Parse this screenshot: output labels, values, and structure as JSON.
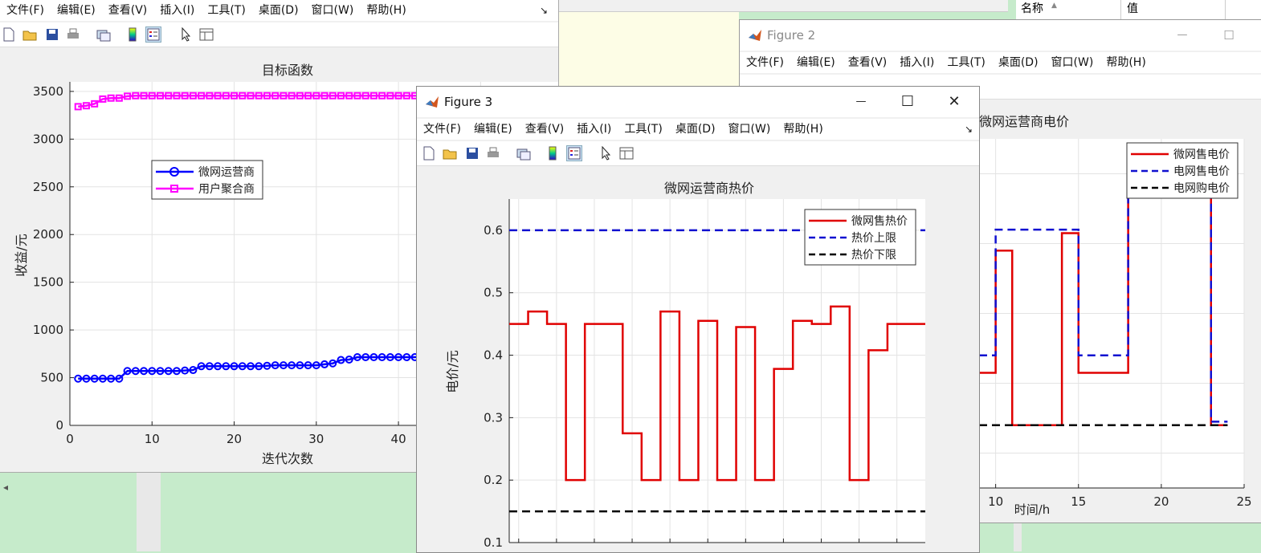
{
  "workspace": {
    "col_name": "名称",
    "col_value": "值",
    "sort_arrow": "▲"
  },
  "menu": [
    "文件(F)",
    "编辑(E)",
    "查看(V)",
    "插入(I)",
    "工具(T)",
    "桌面(D)",
    "窗口(W)",
    "帮助(H)"
  ],
  "fig1": {
    "menu_arrow": "↘",
    "chart_data": {
      "type": "line",
      "title": "目标函数",
      "xlabel": "迭代次数",
      "ylabel": "收益/元",
      "xlim": [
        0,
        48
      ],
      "ylim": [
        0,
        3600
      ],
      "xticks": [
        "0",
        "10",
        "20",
        "30",
        "40"
      ],
      "yticks": [
        "0",
        "500",
        "1000",
        "1500",
        "2000",
        "2500",
        "3000",
        "3500"
      ],
      "grid": true,
      "legend_position": "upper-left",
      "series": [
        {
          "name": "微网运营商",
          "color": "#0000ff",
          "marker": "circle",
          "x": [
            1,
            2,
            3,
            4,
            5,
            6,
            7,
            8,
            9,
            10,
            11,
            12,
            13,
            14,
            15,
            16,
            17,
            18,
            19,
            20,
            21,
            22,
            23,
            24,
            25,
            26,
            27,
            28,
            29,
            30,
            31,
            32,
            33,
            34,
            35,
            36,
            37,
            38,
            39,
            40,
            41,
            42,
            43,
            44,
            45,
            46,
            47
          ],
          "y": [
            490,
            490,
            490,
            490,
            490,
            490,
            570,
            570,
            570,
            570,
            570,
            570,
            570,
            575,
            580,
            620,
            620,
            620,
            620,
            620,
            620,
            620,
            620,
            625,
            630,
            630,
            630,
            630,
            630,
            630,
            640,
            650,
            685,
            690,
            715,
            715,
            715,
            715,
            715,
            715,
            715,
            715,
            718,
            718,
            720,
            720,
            720
          ]
        },
        {
          "name": "用户聚合商",
          "color": "#ff00ff",
          "marker": "square",
          "x": [
            1,
            2,
            3,
            4,
            5,
            6,
            7,
            8,
            9,
            10,
            11,
            12,
            13,
            14,
            15,
            16,
            17,
            18,
            19,
            20,
            21,
            22,
            23,
            24,
            25,
            26,
            27,
            28,
            29,
            30,
            31,
            32,
            33,
            34,
            35,
            36,
            37,
            38,
            39,
            40,
            41,
            42,
            43,
            44,
            45,
            46,
            47
          ],
          "y": [
            3340,
            3350,
            3370,
            3420,
            3430,
            3430,
            3450,
            3455,
            3455,
            3455,
            3455,
            3455,
            3455,
            3455,
            3455,
            3455,
            3455,
            3455,
            3455,
            3455,
            3455,
            3455,
            3455,
            3455,
            3455,
            3455,
            3455,
            3455,
            3455,
            3455,
            3455,
            3455,
            3455,
            3455,
            3455,
            3455,
            3455,
            3455,
            3455,
            3455,
            3455,
            3455,
            3455,
            3455,
            3455,
            3455,
            3455
          ]
        }
      ]
    }
  },
  "fig2": {
    "title": "Figure 2",
    "chart_data": {
      "type": "line",
      "title": "微网运营商电价",
      "xlabel": "时间/h",
      "xlim": [
        9,
        25
      ],
      "xticks": [
        "10",
        "15",
        "20",
        "25"
      ],
      "grid": true,
      "legend_position": "upper-right",
      "series": [
        {
          "name": "微网售电价",
          "color": "#e00000",
          "style": "solid",
          "x": [
            9,
            10,
            10,
            11,
            11,
            14,
            14,
            15,
            15,
            18,
            18,
            23,
            23,
            24
          ],
          "y": [
            0.43,
            0.43,
            0.78,
            0.78,
            0.28,
            0.28,
            0.83,
            0.83,
            0.43,
            0.43,
            0.98,
            0.98,
            0.28,
            0.28
          ]
        },
        {
          "name": "电网售电价",
          "color": "#1010d0",
          "style": "dashed",
          "x": [
            9,
            10,
            10,
            15,
            15,
            18,
            18,
            23,
            23,
            24
          ],
          "y": [
            0.48,
            0.48,
            0.84,
            0.84,
            0.48,
            0.48,
            0.98,
            0.98,
            0.29,
            0.29
          ]
        },
        {
          "name": "电网购电价",
          "color": "#000000",
          "style": "dashed",
          "x": [
            9,
            24
          ],
          "y": [
            0.28,
            0.28
          ]
        }
      ]
    }
  },
  "fig3": {
    "title": "Figure 3",
    "menu": [
      "文件(F)",
      "编辑(E)",
      "查看(V)",
      "插入(I)",
      "工具(T)",
      "桌面(D)",
      "窗口(W)",
      "帮助(H)"
    ],
    "menu_arrow": "↘",
    "chart_data": {
      "type": "line",
      "title": "微网运营商热价",
      "ylabel": "电价/元",
      "ylim": [
        0.1,
        0.65
      ],
      "yticks": [
        "0.1",
        "0.2",
        "0.3",
        "0.4",
        "0.5",
        "0.6"
      ],
      "grid": true,
      "legend_position": "upper-right",
      "series": [
        {
          "name": "微网售热价",
          "color": "#e00000",
          "style": "solid",
          "x": [
            0,
            1,
            1,
            2,
            2,
            3,
            3,
            4,
            4,
            5,
            5,
            6,
            6,
            7,
            7,
            8,
            8,
            9,
            9,
            10,
            10,
            11,
            11,
            12,
            12,
            13,
            13,
            14,
            14,
            15,
            15,
            16,
            16,
            17,
            17,
            18,
            18,
            19,
            19,
            20,
            20,
            21,
            21,
            22
          ],
          "y": [
            0.45,
            0.45,
            0.47,
            0.47,
            0.45,
            0.45,
            0.2,
            0.2,
            0.45,
            0.45,
            0.45,
            0.45,
            0.275,
            0.275,
            0.2,
            0.2,
            0.47,
            0.47,
            0.2,
            0.2,
            0.455,
            0.455,
            0.2,
            0.2,
            0.445,
            0.445,
            0.2,
            0.2,
            0.378,
            0.378,
            0.455,
            0.455,
            0.45,
            0.45,
            0.478,
            0.478,
            0.2,
            0.2,
            0.408,
            0.408,
            0.45,
            0.45,
            0.45,
            0.45
          ]
        },
        {
          "name": "热价上限",
          "color": "#1010d0",
          "style": "dashed",
          "x": [
            0,
            22
          ],
          "y": [
            0.6,
            0.6
          ]
        },
        {
          "name": "热价下限",
          "color": "#000000",
          "style": "dashed",
          "x": [
            0,
            22
          ],
          "y": [
            0.15,
            0.15
          ]
        }
      ]
    }
  },
  "window_controls": {
    "minimize": "—",
    "maximize": "☐",
    "close": "✕"
  }
}
